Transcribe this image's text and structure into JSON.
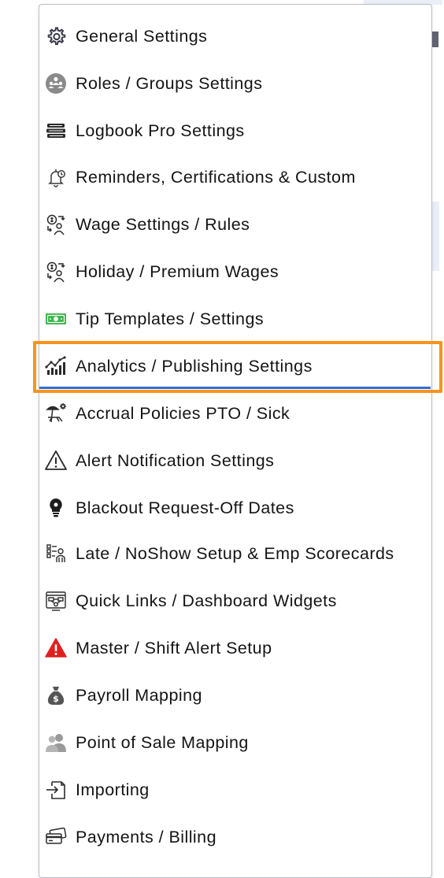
{
  "colors": {
    "accent_underline": "#2f6fd6",
    "focus_ring": "#f7941d",
    "tip_icon": "#39b54a",
    "alert_icon": "#e02020"
  },
  "menu": {
    "items": [
      {
        "label": "General Settings",
        "icon": "gear-icon"
      },
      {
        "label": "Roles / Groups Settings",
        "icon": "roles-groups-icon"
      },
      {
        "label": "Logbook Pro Settings",
        "icon": "logbook-stack-icon"
      },
      {
        "label": "Reminders, Certifications & Custom",
        "icon": "bell-clock-icon"
      },
      {
        "label": "Wage Settings / Rules",
        "icon": "wage-exchange-icon"
      },
      {
        "label": "Holiday / Premium Wages",
        "icon": "holiday-wage-icon"
      },
      {
        "label": "Tip Templates / Settings",
        "icon": "money-bill-icon"
      },
      {
        "label": "Analytics / Publishing Settings",
        "icon": "analytics-chart-icon",
        "selected": true
      },
      {
        "label": "Accrual Policies PTO / Sick",
        "icon": "beach-chair-icon"
      },
      {
        "label": "Alert Notification Settings",
        "icon": "warning-outline-icon"
      },
      {
        "label": "Blackout Request-Off Dates",
        "icon": "lightbulb-gear-icon"
      },
      {
        "label": "Late / NoShow Setup & Emp Scorecards",
        "icon": "scorecard-icon"
      },
      {
        "label": "Quick Links / Dashboard Widgets",
        "icon": "dashboard-widgets-icon"
      },
      {
        "label": "Master / Shift Alert Setup",
        "icon": "warning-red-icon"
      },
      {
        "label": "Payroll Mapping",
        "icon": "money-bag-icon"
      },
      {
        "label": "Point of Sale Mapping",
        "icon": "users-icon"
      },
      {
        "label": "Importing",
        "icon": "import-icon"
      },
      {
        "label": "Payments / Billing",
        "icon": "credit-cards-icon"
      }
    ]
  }
}
